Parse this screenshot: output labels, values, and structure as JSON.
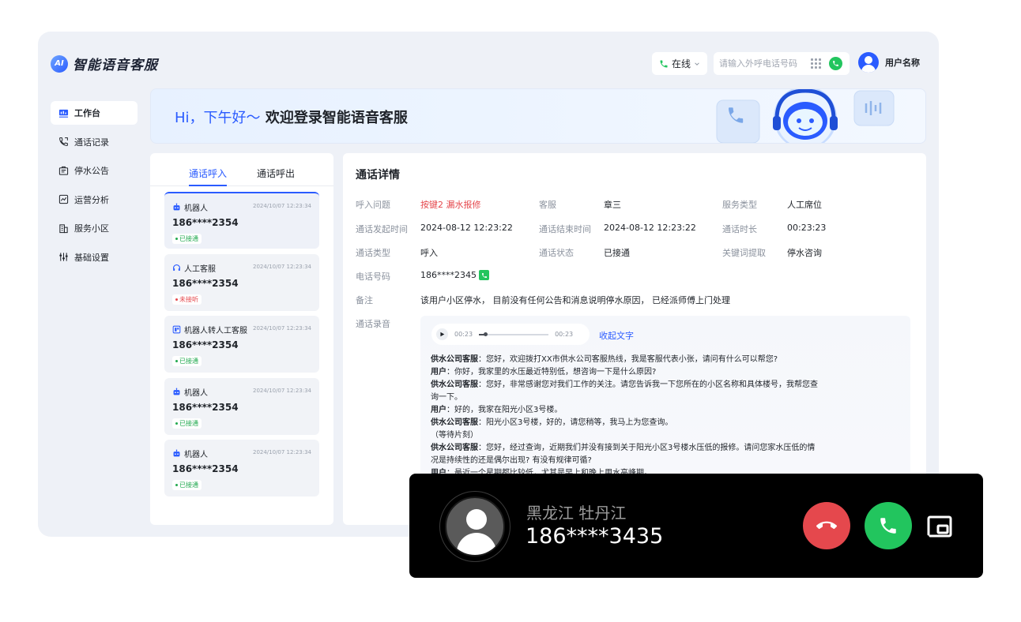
{
  "app": {
    "logo_mark": "AI",
    "title": "智能语音客服"
  },
  "header": {
    "status": "在线",
    "search_placeholder": "请输入外呼电话号码",
    "user_name": "用户名称"
  },
  "sidebar": {
    "items": [
      {
        "label": "工作台",
        "icon": "dashboard-icon",
        "active": true
      },
      {
        "label": "通话记录",
        "icon": "phone-record-icon",
        "active": false
      },
      {
        "label": "停水公告",
        "icon": "notice-icon",
        "active": false
      },
      {
        "label": "运营分析",
        "icon": "analytics-icon",
        "active": false
      },
      {
        "label": "服务小区",
        "icon": "building-icon",
        "active": false
      },
      {
        "label": "基础设置",
        "icon": "settings-sliders-icon",
        "active": false
      }
    ]
  },
  "banner": {
    "greeting": "Hi，下午好～",
    "welcome": "欢迎登录智能语音客服"
  },
  "tabs": [
    "通话呼入",
    "通话呼出"
  ],
  "calls": [
    {
      "type": "机器人",
      "icon": "robot-icon",
      "time": "2024/10/07 12:23:34",
      "phone": "186****2354",
      "status": "已接通",
      "status_kind": "ok"
    },
    {
      "type": "人工客服",
      "icon": "headset-icon",
      "time": "2024/10/07 12:23:34",
      "phone": "186****2354",
      "status": "未接听",
      "status_kind": "miss"
    },
    {
      "type": "机器人转人工客服",
      "icon": "transfer-icon",
      "time": "2024/10/07 12:23:34",
      "phone": "186****2354",
      "status": "已接通",
      "status_kind": "ok"
    },
    {
      "type": "机器人",
      "icon": "robot-icon",
      "time": "2024/10/07 12:23:34",
      "phone": "186****2354",
      "status": "已接通",
      "status_kind": "ok"
    },
    {
      "type": "机器人",
      "icon": "robot-icon",
      "time": "2024/10/07 12:23:34",
      "phone": "186****2354",
      "status": "已接通",
      "status_kind": "ok"
    }
  ],
  "detail": {
    "title": "通话详情",
    "fields": {
      "issue_label": "呼入问题",
      "issue": "按键2 漏水报修",
      "agent_label": "客服",
      "agent": "章三",
      "service_label": "服务类型",
      "service": "人工席位",
      "start_label": "通话发起时间",
      "start": "2024-08-12 12:23:22",
      "end_label": "通话结束时间",
      "end": "2024-08-12 12:23:22",
      "duration_label": "通话时长",
      "duration": "00:23:23",
      "calltype_label": "通话类型",
      "calltype": "呼入",
      "callstatus_label": "通话状态",
      "callstatus": "已接通",
      "keyword_label": "关键词提取",
      "keyword": "停水咨询",
      "phone_label": "电话号码",
      "phone": "186****2345",
      "note_label": "备注",
      "note": "该用户小区停水， 目前没有任何公告和消息说明停水原因， 已经派师傅上门处理",
      "record_label": "通话录音"
    },
    "player": {
      "current": "00:23",
      "total": "00:23",
      "progress": 0.08
    },
    "collapse_label": "收起文字",
    "transcript": [
      {
        "speaker": "供水公司客服",
        "text": "您好，欢迎拨打XX市供水公司客服热线，我是客服代表小张，请问有什么可以帮您?"
      },
      {
        "speaker": "用户",
        "text": "你好，我家里的水压最近特别低，想咨询一下是什么原因?"
      },
      {
        "speaker": "供水公司客服",
        "text": "您好，非常感谢您对我们工作的关注。请您告诉我一下您所在的小区名称和具体楼号，我帮您查询一下。"
      },
      {
        "speaker": "用户",
        "text": "好的，我家在阳光小区3号楼。"
      },
      {
        "speaker": "供水公司客服",
        "text": "阳光小区3号楼，好的，请您稍等，我马上为您查询。"
      },
      {
        "speaker": "",
        "text": "（等待片刻）"
      },
      {
        "speaker": "供水公司客服",
        "text": "您好，经过查询，近期我们并没有接到关于阳光小区3号楼水压低的报修。请问您家水压低的情况是持续性的还是偶尔出现? 有没有规律可循?"
      },
      {
        "speaker": "用户",
        "text": "最近一个星期都比较低，尤其是早上和晚上用水高峰期。"
      }
    ]
  },
  "incoming_call": {
    "location": "黑龙江 牡丹江",
    "number": "186****3435"
  },
  "colors": {
    "accent": "#2a5bff",
    "success": "#22c55e",
    "danger": "#e5484d"
  }
}
